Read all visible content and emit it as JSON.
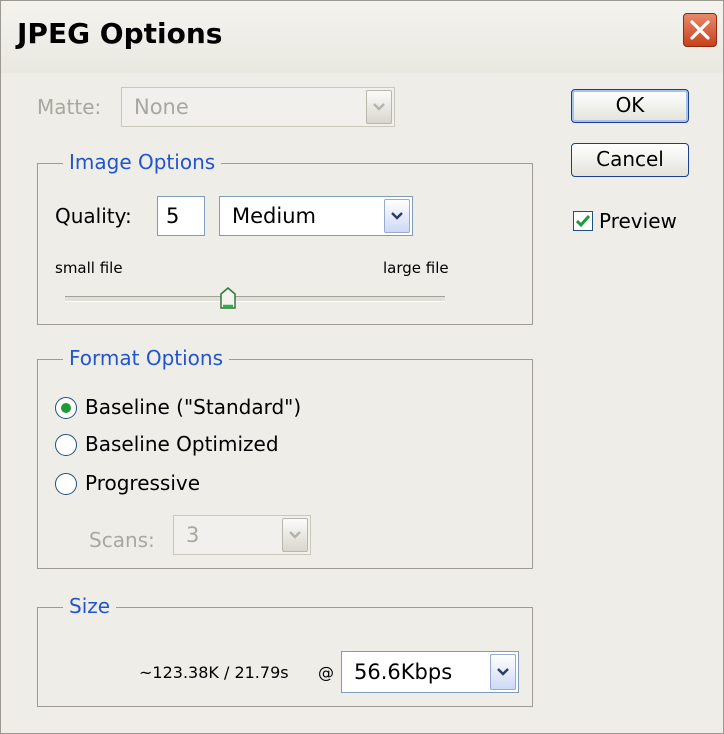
{
  "window": {
    "title": "JPEG Options",
    "close_icon": "close-icon"
  },
  "matte": {
    "label": "Matte:",
    "value": "None"
  },
  "buttons": {
    "ok": "OK",
    "cancel": "Cancel"
  },
  "preview": {
    "label": "Preview",
    "checked": true
  },
  "image_options": {
    "legend": "Image Options",
    "quality_label": "Quality:",
    "quality_value": "5",
    "quality_preset": "Medium",
    "small_label": "small file",
    "large_label": "large file",
    "slider_fraction": 0.43
  },
  "format_options": {
    "legend": "Format Options",
    "options": [
      "Baseline (\"Standard\")",
      "Baseline Optimized",
      "Progressive"
    ],
    "selected_index": 0,
    "scans_label": "Scans:",
    "scans_value": "3"
  },
  "size": {
    "legend": "Size",
    "estimate": "~123.38K / 21.79s",
    "at": "@",
    "speed": "56.6Kbps"
  },
  "colors": {
    "accent": "#2255cc",
    "radio_selected": "#1f9a39",
    "check": "#1f9a39"
  }
}
